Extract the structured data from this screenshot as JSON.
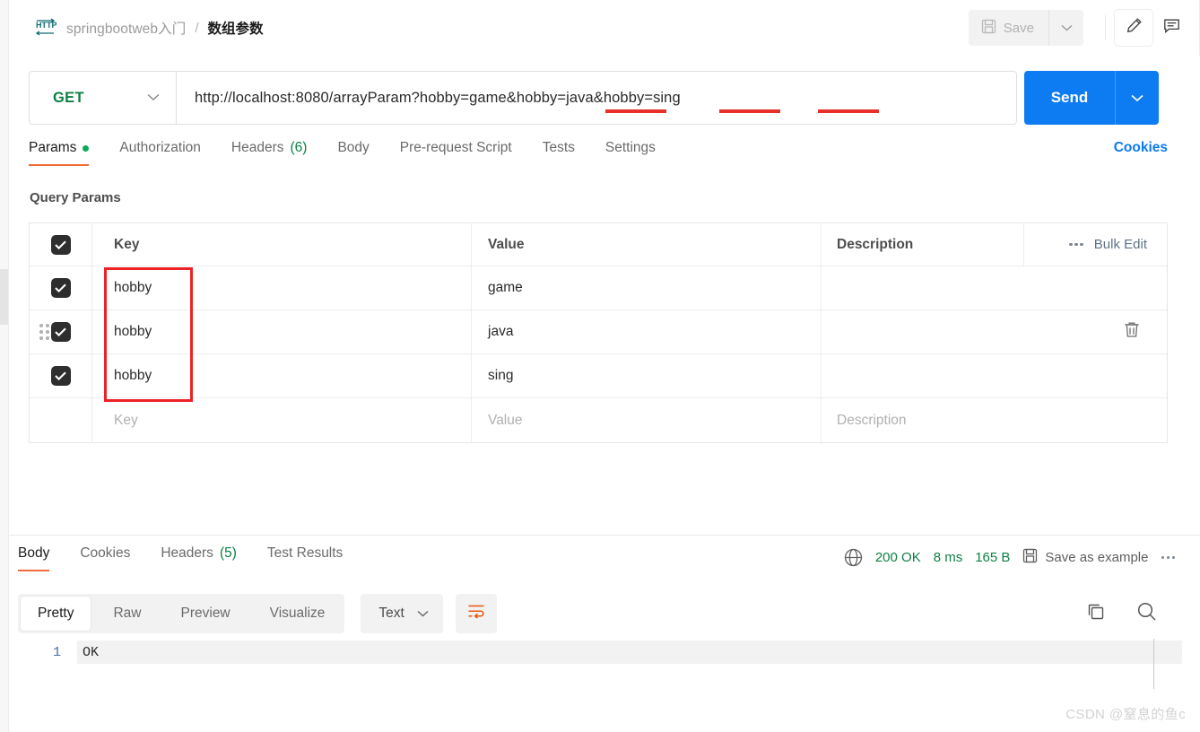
{
  "header": {
    "icon": "http-icon",
    "breadcrumb_folder": "springbootweb入门",
    "breadcrumb_separator": "/",
    "breadcrumb_current": "数组参数",
    "save_label": "Save",
    "save_caret": "chevron-down-icon",
    "edit_icon": "pencil-icon",
    "comment_icon": "comment-icon"
  },
  "request": {
    "method": "GET",
    "url": "http://localhost:8080/arrayParam?hobby=game&hobby=java&hobby=sing",
    "send_label": "Send",
    "tabs": [
      {
        "label": "Params",
        "active": true,
        "dot": true
      },
      {
        "label": "Authorization",
        "active": false
      },
      {
        "label": "Headers",
        "count": "(6)",
        "active": false
      },
      {
        "label": "Body",
        "active": false
      },
      {
        "label": "Pre-request Script",
        "active": false
      },
      {
        "label": "Tests",
        "active": false
      },
      {
        "label": "Settings",
        "active": false
      }
    ],
    "cookies_link": "Cookies"
  },
  "params": {
    "section_title": "Query Params",
    "columns": {
      "key": "Key",
      "value": "Value",
      "description": "Description"
    },
    "bulk_edit": "Bulk Edit",
    "rows": [
      {
        "checked": true,
        "key": "hobby",
        "value": "game",
        "description": ""
      },
      {
        "checked": true,
        "key": "hobby",
        "value": "java",
        "description": ""
      },
      {
        "checked": true,
        "key": "hobby",
        "value": "sing",
        "description": ""
      }
    ],
    "empty_row": {
      "key": "Key",
      "value": "Value",
      "description": "Description"
    }
  },
  "response": {
    "tabs": [
      {
        "label": "Body",
        "active": true
      },
      {
        "label": "Cookies",
        "active": false
      },
      {
        "label": "Headers",
        "count": "(5)",
        "active": false
      },
      {
        "label": "Test Results",
        "active": false
      }
    ],
    "status_code": "200 OK",
    "time": "8 ms",
    "size": "165 B",
    "save_example": "Save as example",
    "more_icon": "ellipsis-icon",
    "view_modes": [
      {
        "label": "Pretty",
        "active": true
      },
      {
        "label": "Raw",
        "active": false
      },
      {
        "label": "Preview",
        "active": false
      },
      {
        "label": "Visualize",
        "active": false
      }
    ],
    "content_type": "Text",
    "body_lines": [
      {
        "number": "1",
        "text": "OK"
      }
    ]
  },
  "watermark": "CSDN @窒息的鱼c",
  "colors": {
    "accent_blue": "#0d7bf2",
    "method_green": "#0d8043",
    "tab_underline": "#f26b3a",
    "annotation_red": "#ec2227",
    "checkbox": "#2e2e2e"
  }
}
